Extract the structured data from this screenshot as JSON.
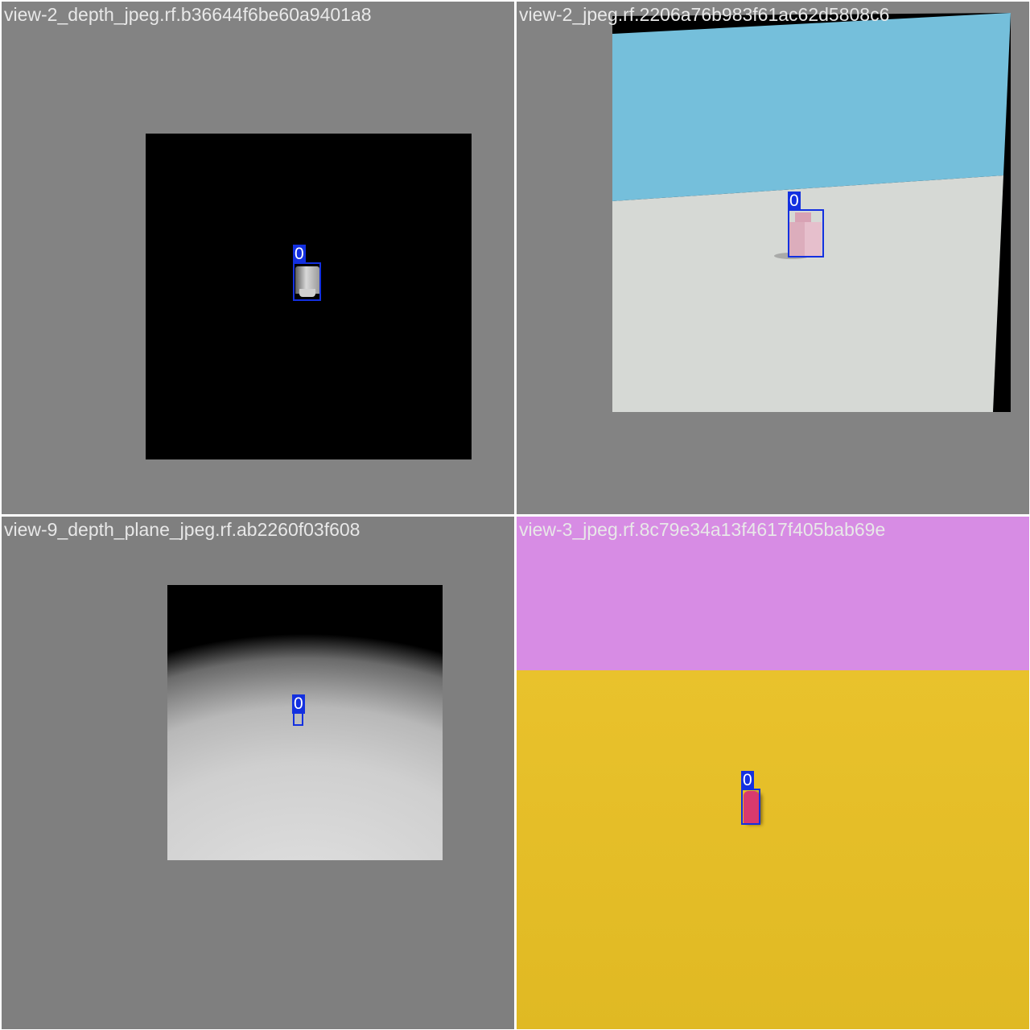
{
  "tiles": [
    {
      "filename": "view-2_depth_jpeg.rf.b36644f6be60a9401a8",
      "annotations": [
        {
          "class_label": "0"
        }
      ]
    },
    {
      "filename": "view-2_jpeg.rf.2206a76b983f61ac62d5808c6",
      "annotations": [
        {
          "class_label": "0"
        }
      ]
    },
    {
      "filename": "view-9_depth_plane_jpeg.rf.ab2260f03f608",
      "annotations": [
        {
          "class_label": "0"
        }
      ]
    },
    {
      "filename": "view-3_jpeg.rf.8c79e34a13f4617f405bab69e",
      "annotations": [
        {
          "class_label": "0"
        }
      ]
    }
  ],
  "colors": {
    "background_gray": "#838383",
    "bbox_blue": "#1330e0",
    "sky_blue": "#75bfdb",
    "ground_light": "#d6d9d5",
    "sky_pink": "#d78ce4",
    "ground_yellow": "#e6bf29",
    "object_pink": "#d93a6e"
  }
}
